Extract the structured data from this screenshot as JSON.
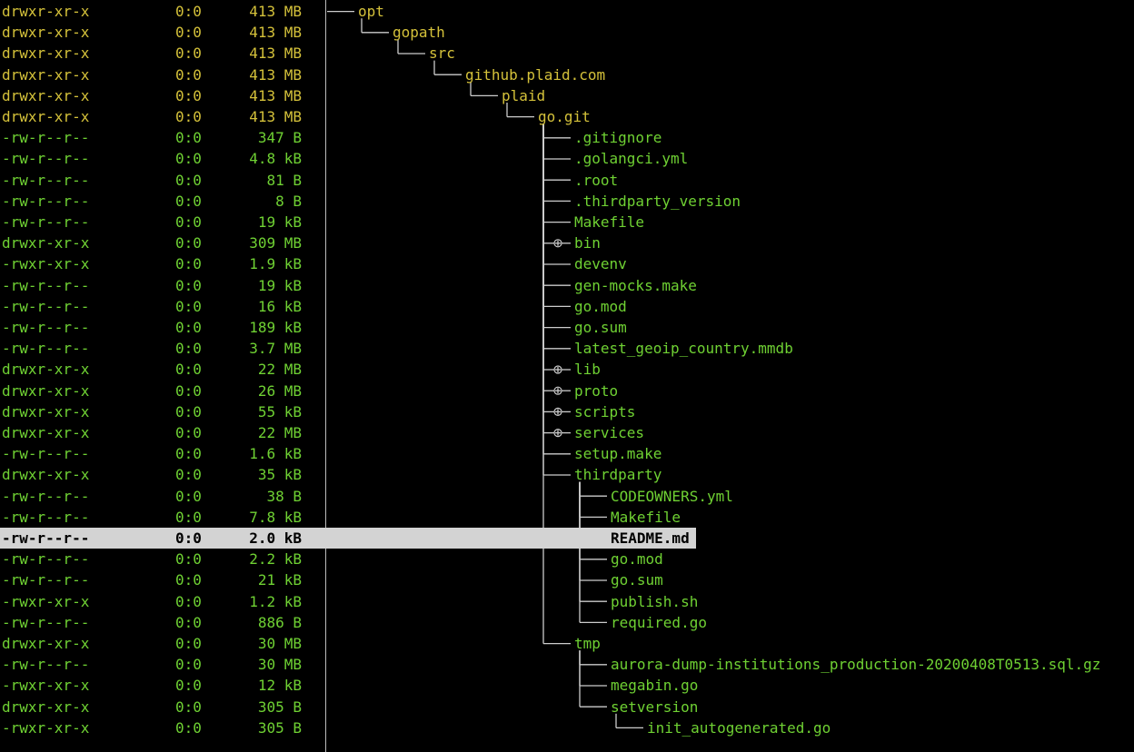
{
  "colors": {
    "background": "#000000",
    "directory_text": "#d4c13a",
    "file_text": "#6fd133",
    "selected_bg": "#d3d3d3",
    "tree_lines": "#cccccc"
  },
  "rows": [
    {
      "perm": "drwxr-xr-x",
      "owner": "0:0",
      "size": "413 MB",
      "name": "opt",
      "depth": 0,
      "type": "dir"
    },
    {
      "perm": "drwxr-xr-x",
      "owner": "0:0",
      "size": "413 MB",
      "name": "gopath",
      "depth": 1,
      "type": "dir"
    },
    {
      "perm": "drwxr-xr-x",
      "owner": "0:0",
      "size": "413 MB",
      "name": "src",
      "depth": 2,
      "type": "dir"
    },
    {
      "perm": "drwxr-xr-x",
      "owner": "0:0",
      "size": "413 MB",
      "name": "github.plaid.com",
      "depth": 3,
      "type": "dir"
    },
    {
      "perm": "drwxr-xr-x",
      "owner": "0:0",
      "size": "413 MB",
      "name": "plaid",
      "depth": 4,
      "type": "dir"
    },
    {
      "perm": "drwxr-xr-x",
      "owner": "0:0",
      "size": "413 MB",
      "name": "go.git",
      "depth": 5,
      "type": "dir"
    },
    {
      "perm": "-rw-r--r--",
      "owner": "0:0",
      "size": "347 B",
      "name": ".gitignore",
      "depth": 6,
      "type": "file"
    },
    {
      "perm": "-rw-r--r--",
      "owner": "0:0",
      "size": "4.8 kB",
      "name": ".golangci.yml",
      "depth": 6,
      "type": "file"
    },
    {
      "perm": "-rw-r--r--",
      "owner": "0:0",
      "size": "81 B",
      "name": ".root",
      "depth": 6,
      "type": "file"
    },
    {
      "perm": "-rw-r--r--",
      "owner": "0:0",
      "size": "8 B",
      "name": ".thirdparty_version",
      "depth": 6,
      "type": "file"
    },
    {
      "perm": "-rw-r--r--",
      "owner": "0:0",
      "size": "19 kB",
      "name": "Makefile",
      "depth": 6,
      "type": "file"
    },
    {
      "perm": "drwxr-xr-x",
      "owner": "0:0",
      "size": "309 MB",
      "name": "bin",
      "depth": 6,
      "type": "file",
      "collapsed": true
    },
    {
      "perm": "-rwxr-xr-x",
      "owner": "0:0",
      "size": "1.9 kB",
      "name": "devenv",
      "depth": 6,
      "type": "file"
    },
    {
      "perm": "-rw-r--r--",
      "owner": "0:0",
      "size": "19 kB",
      "name": "gen-mocks.make",
      "depth": 6,
      "type": "file"
    },
    {
      "perm": "-rw-r--r--",
      "owner": "0:0",
      "size": "16 kB",
      "name": "go.mod",
      "depth": 6,
      "type": "file"
    },
    {
      "perm": "-rw-r--r--",
      "owner": "0:0",
      "size": "189 kB",
      "name": "go.sum",
      "depth": 6,
      "type": "file"
    },
    {
      "perm": "-rw-r--r--",
      "owner": "0:0",
      "size": "3.7 MB",
      "name": "latest_geoip_country.mmdb",
      "depth": 6,
      "type": "file"
    },
    {
      "perm": "drwxr-xr-x",
      "owner": "0:0",
      "size": "22 MB",
      "name": "lib",
      "depth": 6,
      "type": "file",
      "collapsed": true
    },
    {
      "perm": "drwxr-xr-x",
      "owner": "0:0",
      "size": "26 MB",
      "name": "proto",
      "depth": 6,
      "type": "file",
      "collapsed": true
    },
    {
      "perm": "drwxr-xr-x",
      "owner": "0:0",
      "size": "55 kB",
      "name": "scripts",
      "depth": 6,
      "type": "file",
      "collapsed": true
    },
    {
      "perm": "drwxr-xr-x",
      "owner": "0:0",
      "size": "22 MB",
      "name": "services",
      "depth": 6,
      "type": "file",
      "collapsed": true
    },
    {
      "perm": "-rw-r--r--",
      "owner": "0:0",
      "size": "1.6 kB",
      "name": "setup.make",
      "depth": 6,
      "type": "file"
    },
    {
      "perm": "drwxr-xr-x",
      "owner": "0:0",
      "size": "35 kB",
      "name": "thirdparty",
      "depth": 6,
      "type": "file"
    },
    {
      "perm": "-rw-r--r--",
      "owner": "0:0",
      "size": "38 B",
      "name": "CODEOWNERS.yml",
      "depth": 7,
      "type": "file"
    },
    {
      "perm": "-rw-r--r--",
      "owner": "0:0",
      "size": "7.8 kB",
      "name": "Makefile",
      "depth": 7,
      "type": "file"
    },
    {
      "perm": "-rw-r--r--",
      "owner": "0:0",
      "size": "2.0 kB",
      "name": "README.md",
      "depth": 7,
      "type": "file",
      "selected": true
    },
    {
      "perm": "-rw-r--r--",
      "owner": "0:0",
      "size": "2.2 kB",
      "name": "go.mod",
      "depth": 7,
      "type": "file"
    },
    {
      "perm": "-rw-r--r--",
      "owner": "0:0",
      "size": "21 kB",
      "name": "go.sum",
      "depth": 7,
      "type": "file"
    },
    {
      "perm": "-rwxr-xr-x",
      "owner": "0:0",
      "size": "1.2 kB",
      "name": "publish.sh",
      "depth": 7,
      "type": "file"
    },
    {
      "perm": "-rw-r--r--",
      "owner": "0:0",
      "size": "886 B",
      "name": "required.go",
      "depth": 7,
      "type": "file"
    },
    {
      "perm": "drwxr-xr-x",
      "owner": "0:0",
      "size": "30 MB",
      "name": "tmp",
      "depth": 6,
      "type": "file"
    },
    {
      "perm": "-rw-r--r--",
      "owner": "0:0",
      "size": "30 MB",
      "name": "aurora-dump-institutions_production-20200408T0513.sql.gz",
      "depth": 7,
      "type": "file"
    },
    {
      "perm": "-rwxr-xr-x",
      "owner": "0:0",
      "size": "12 kB",
      "name": "megabin.go",
      "depth": 7,
      "type": "file"
    },
    {
      "perm": "drwxr-xr-x",
      "owner": "0:0",
      "size": "305 B",
      "name": "setversion",
      "depth": 7,
      "type": "file"
    },
    {
      "perm": "-rwxr-xr-x",
      "owner": "0:0",
      "size": "305 B",
      "name": "init_autogenerated.go",
      "depth": 8,
      "type": "file"
    }
  ]
}
